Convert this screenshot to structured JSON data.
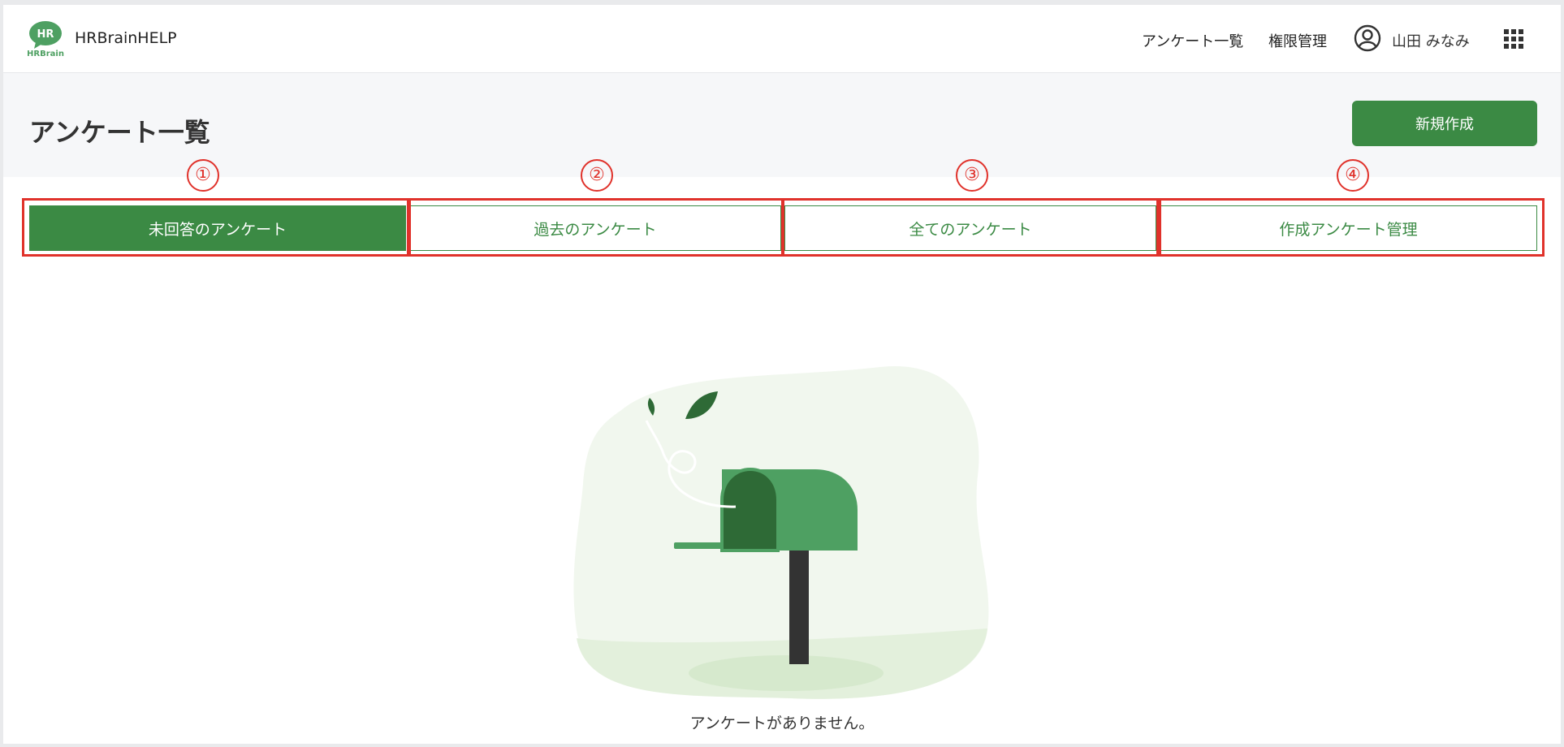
{
  "header": {
    "brand_name": "HRBrainHELP",
    "logo_badge": "HR",
    "logo_text": "HRBrain",
    "nav": [
      {
        "label": "アンケート一覧"
      },
      {
        "label": "権限管理"
      }
    ],
    "user_name": "山田 みなみ",
    "icons": {
      "user": "user-circle-icon",
      "apps": "grid-apps-icon"
    }
  },
  "page": {
    "title": "アンケート一覧",
    "new_button_label": "新規作成"
  },
  "markers": [
    "①",
    "②",
    "③",
    "④"
  ],
  "tabs": [
    {
      "label": "未回答のアンケート",
      "active": true
    },
    {
      "label": "過去のアンケート",
      "active": false
    },
    {
      "label": "全てのアンケート",
      "active": false
    },
    {
      "label": "作成アンケート管理",
      "active": false
    }
  ],
  "empty_state": {
    "message": "アンケートがありません。",
    "illustration": "mailbox-illustration"
  },
  "colors": {
    "accent": "#3b8a44",
    "annotation": "#e0322b",
    "background": "#ffffff",
    "title_band": "#f6f7f9"
  }
}
